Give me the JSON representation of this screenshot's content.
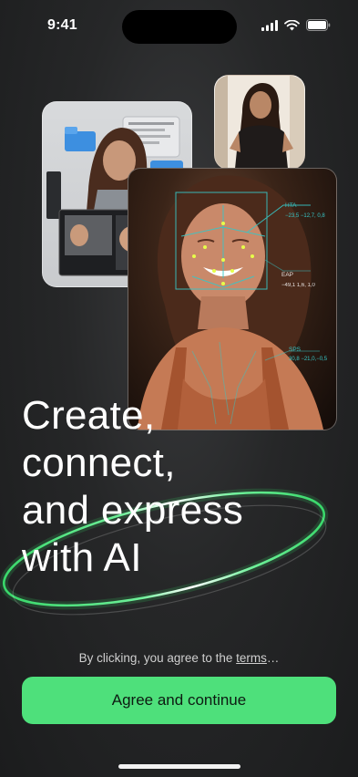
{
  "status_bar": {
    "time": "9:41"
  },
  "hero": {
    "title_lines": [
      "Create,",
      "connect,",
      "and express",
      "with AI"
    ]
  },
  "face_overlay": {
    "labels": [
      {
        "title": "HTA",
        "values": "−23,5 −12,7, 0,8"
      },
      {
        "title": "EAP",
        "values": "−49,1  1,6, 1,0"
      },
      {
        "title": "SPS",
        "values": "30,8  −21,0,−0,5"
      }
    ]
  },
  "consent": {
    "prefix": "By clicking, you agree to the ",
    "link": "terms",
    "suffix": "…"
  },
  "cta": {
    "label": "Agree and continue"
  },
  "colors": {
    "accent": "#4ee07b",
    "overlay": "#37c7c7",
    "background": "#262728"
  }
}
